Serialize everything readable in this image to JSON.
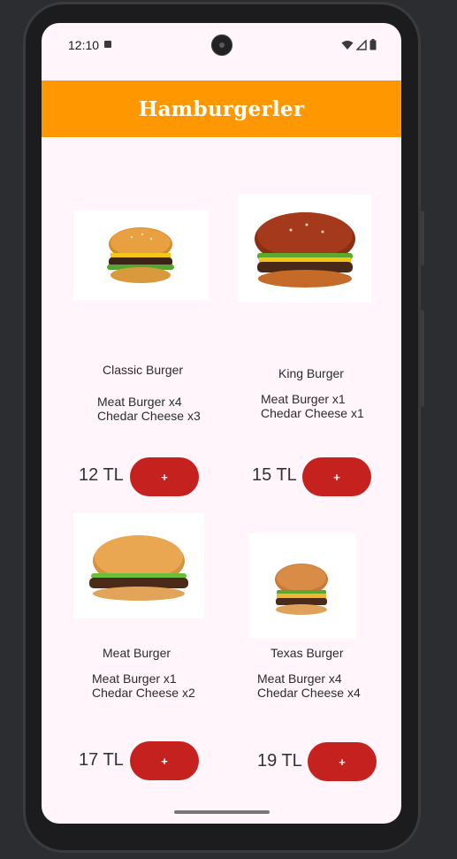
{
  "status_bar": {
    "time": "12:10"
  },
  "header": {
    "title": "Hamburgerler"
  },
  "products": [
    {
      "name": "Classic Burger",
      "desc1": "Meat Burger x4",
      "desc2": "Chedar Cheese x3",
      "price": "12 TL",
      "add_label": "+"
    },
    {
      "name": "King Burger",
      "desc1": "Meat Burger x1",
      "desc2": "Chedar Cheese x1",
      "price": "15 TL",
      "add_label": "+"
    },
    {
      "name": "Meat Burger",
      "desc1": "Meat Burger x1",
      "desc2": "Chedar Cheese x2",
      "price": "17 TL",
      "add_label": "+"
    },
    {
      "name": "Texas Burger",
      "desc1": "Meat Burger x4",
      "desc2": "Chedar Cheese x4",
      "price": "19 TL",
      "add_label": "+"
    }
  ],
  "colors": {
    "header": "#ff9800",
    "button": "#c5221f",
    "background": "#fff5fb"
  },
  "icons": [
    "wifi-icon",
    "signal-icon",
    "battery-icon",
    "notification-a-icon"
  ]
}
